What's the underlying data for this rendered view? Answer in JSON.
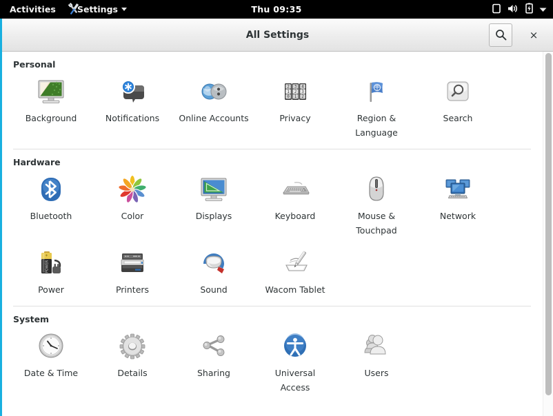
{
  "topbar": {
    "activities": "Activities",
    "app_menu_label": "Settings",
    "app_menu_icon": "wrench-screwdriver-icon",
    "app_menu_arrow": "chevron-down-icon",
    "clock": "Thu 09:35",
    "status_icons": [
      {
        "name": "screen-icon"
      },
      {
        "name": "volume-icon"
      },
      {
        "name": "battery-charging-icon"
      },
      {
        "name": "chevron-down-icon"
      }
    ]
  },
  "window": {
    "title": "All Settings",
    "search_button_icon": "search-icon",
    "close_button_label": "×",
    "accent_color": "#19b0e0"
  },
  "sections": [
    {
      "title": "Personal",
      "items": [
        {
          "label": "Background",
          "icon": "background-monitor-icon"
        },
        {
          "label": "Notifications",
          "icon": "notifications-bubble-icon"
        },
        {
          "label": "Online Accounts",
          "icon": "online-accounts-globe-icon"
        },
        {
          "label": "Privacy",
          "icon": "privacy-counter-icon"
        },
        {
          "label": "Region & Language",
          "icon": "region-flag-icon"
        },
        {
          "label": "Search",
          "icon": "search-magnifier-icon"
        }
      ]
    },
    {
      "title": "Hardware",
      "items": [
        {
          "label": "Bluetooth",
          "icon": "bluetooth-icon"
        },
        {
          "label": "Color",
          "icon": "color-flower-icon"
        },
        {
          "label": "Displays",
          "icon": "displays-monitor-icon"
        },
        {
          "label": "Keyboard",
          "icon": "keyboard-icon"
        },
        {
          "label": "Mouse & Touchpad",
          "icon": "mouse-icon"
        },
        {
          "label": "Network",
          "icon": "network-computers-icon"
        },
        {
          "label": "Power",
          "icon": "power-battery-icon"
        },
        {
          "label": "Printers",
          "icon": "printer-icon"
        },
        {
          "label": "Sound",
          "icon": "sound-speaker-icon"
        },
        {
          "label": "Wacom Tablet",
          "icon": "wacom-tablet-icon"
        }
      ]
    },
    {
      "title": "System",
      "items": [
        {
          "label": "Date & Time",
          "icon": "clock-icon"
        },
        {
          "label": "Details",
          "icon": "gear-icon"
        },
        {
          "label": "Sharing",
          "icon": "share-nodes-icon"
        },
        {
          "label": "Universal Access",
          "icon": "universal-access-icon"
        },
        {
          "label": "Users",
          "icon": "users-icon"
        }
      ]
    }
  ]
}
